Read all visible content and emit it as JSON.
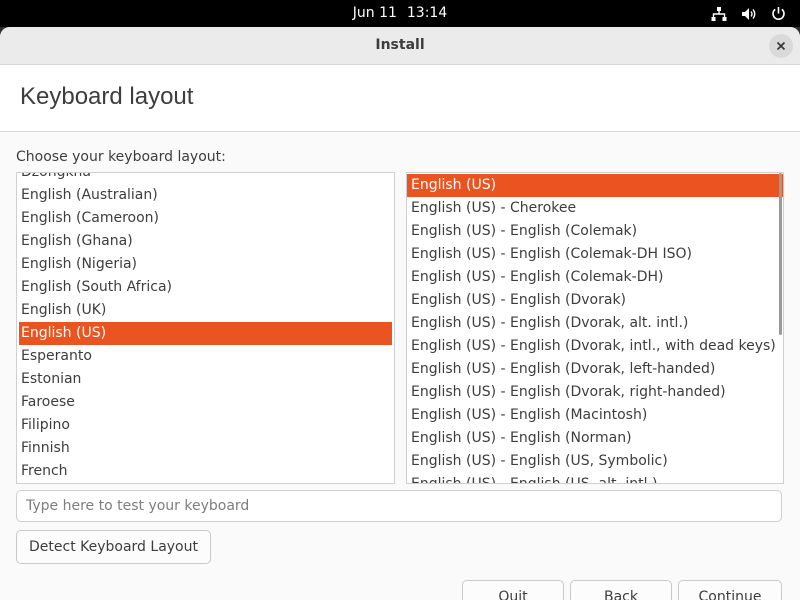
{
  "topbar": {
    "date": "Jun 11",
    "time": "13:14",
    "icons": [
      "network-icon",
      "volume-icon",
      "power-icon"
    ]
  },
  "window": {
    "title": "Install",
    "close_icon": "close-icon"
  },
  "page": {
    "title": "Keyboard layout",
    "prompt": "Choose your keyboard layout:"
  },
  "layouts": {
    "items": [
      "Dzongkha",
      "English (Australian)",
      "English (Cameroon)",
      "English (Ghana)",
      "English (Nigeria)",
      "English (South Africa)",
      "English (UK)",
      "English (US)",
      "Esperanto",
      "Estonian",
      "Faroese",
      "Filipino",
      "Finnish",
      "French"
    ],
    "selected": "English (US)"
  },
  "variants": {
    "items": [
      "English (US)",
      "English (US) - Cherokee",
      "English (US) - English (Colemak)",
      "English (US) - English (Colemak-DH ISO)",
      "English (US) - English (Colemak-DH)",
      "English (US) - English (Dvorak)",
      "English (US) - English (Dvorak, alt. intl.)",
      "English (US) - English (Dvorak, intl., with dead keys)",
      "English (US) - English (Dvorak, left-handed)",
      "English (US) - English (Dvorak, right-handed)",
      "English (US) - English (Macintosh)",
      "English (US) - English (Norman)",
      "English (US) - English (US, Symbolic)",
      "English (US) - English (US, alt. intl.)"
    ],
    "selected": "English (US)"
  },
  "test_input": {
    "placeholder": "Type here to test your keyboard",
    "value": ""
  },
  "buttons": {
    "detect": "Detect Keyboard Layout",
    "quit": "Quit",
    "back": "Back",
    "continue": "Continue"
  },
  "colors": {
    "accent": "#e95420",
    "topbar": "#000000",
    "titlebar": "#ebebeb"
  }
}
